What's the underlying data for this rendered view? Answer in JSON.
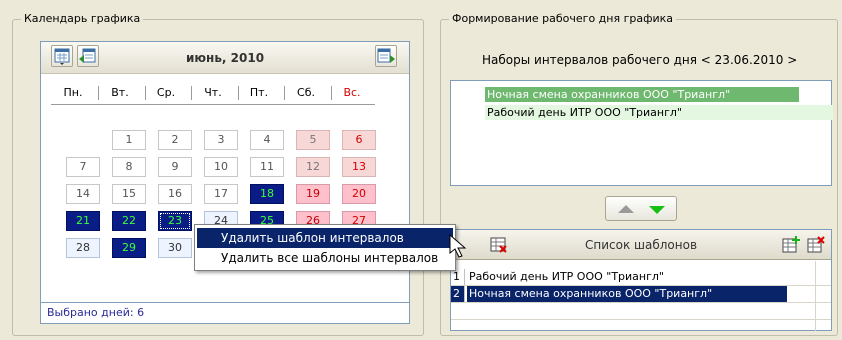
{
  "calendar": {
    "group_title": "Календарь графика",
    "month_label": "июнь, 2010",
    "weekdays": [
      "Пн.",
      "Вт.",
      "Ср.",
      "Чт.",
      "Пт.",
      "Сб.",
      "Вс."
    ],
    "days": [
      "1",
      "2",
      "3",
      "4",
      "5",
      "6",
      "7",
      "8",
      "9",
      "10",
      "11",
      "12",
      "13",
      "14",
      "15",
      "16",
      "17",
      "18",
      "19",
      "20",
      "21",
      "22",
      "23",
      "24",
      "25",
      "26",
      "27",
      "28",
      "29",
      "30"
    ],
    "status": "Выбрано дней:  6"
  },
  "workday": {
    "group_title": "Формирование рабочего дня графика",
    "intervals_title": "Наборы интервалов рабочего дня < 23.06.2010 >",
    "interval_sets": [
      "Ночная смена охранников ООО \"Триангл\"",
      "Рабочий день ИТР ООО \"Триангл\""
    ]
  },
  "templates": {
    "header_label": "Список шаблонов",
    "rows": [
      {
        "num": "1",
        "name": "Рабочий день ИТР ООО \"Триангл\""
      },
      {
        "num": "2",
        "name": "Ночная смена охранников ООО \"Триангл\""
      }
    ]
  },
  "context_menu": {
    "items": [
      "Удалить шаблон интервалов",
      "Удалить все шаблоны интервалов"
    ]
  },
  "colors": {
    "selected_day": "#0a1d86",
    "selected_day_text": "#39ff39",
    "weekend": "#f8d7d7",
    "sunday_text": "#d40000",
    "interval_selected": "#6fb86f",
    "grid_selection": "#0a246a"
  }
}
